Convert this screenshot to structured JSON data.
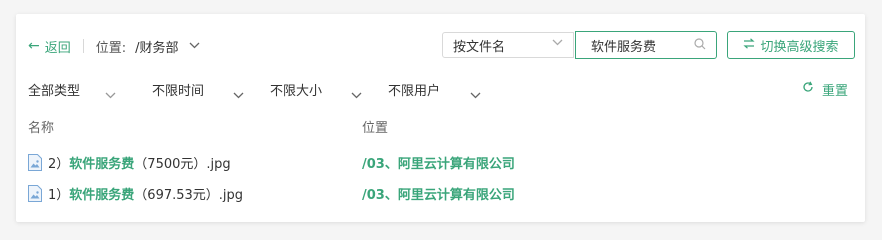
{
  "header": {
    "back_label": "返回",
    "location_label": "位置:",
    "location_value": "/财务部"
  },
  "search": {
    "mode_selected": "按文件名",
    "query": "软件服务费",
    "advanced_label": "切换高级搜索"
  },
  "filters": {
    "type": "全部类型",
    "time": "不限时间",
    "size": "不限大小",
    "user": "不限用户",
    "reset_label": "重置"
  },
  "columns": {
    "name": "名称",
    "location": "位置"
  },
  "files": [
    {
      "prefix": "2）",
      "highlight": "软件服务费",
      "suffix": "（7500元）.jpg",
      "path": "/03、阿里云计算有限公司"
    },
    {
      "prefix": "1）",
      "highlight": "软件服务费",
      "suffix": "（697.53元）.jpg",
      "path": "/03、阿里云计算有限公司"
    }
  ],
  "colors": {
    "accent": "#3aa57a",
    "border": "#d9d9d9",
    "background": "#f5f5f5"
  }
}
